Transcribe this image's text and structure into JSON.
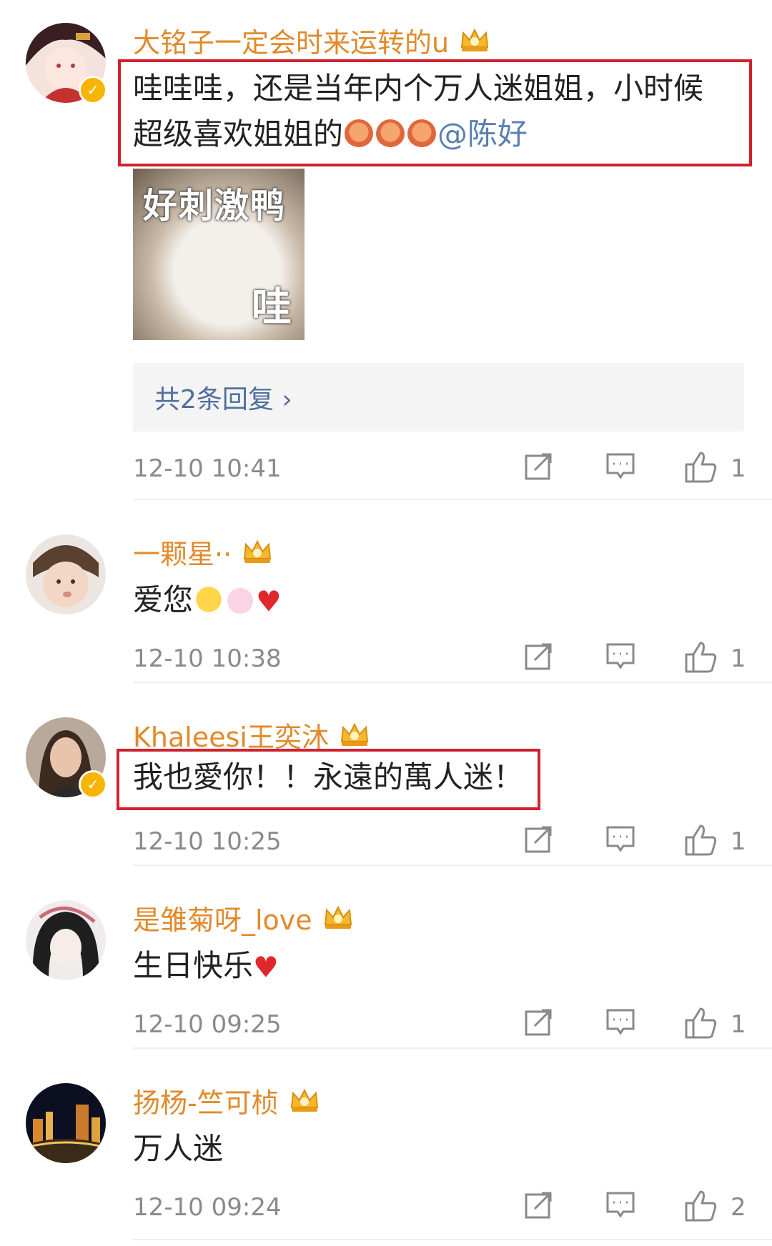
{
  "comments": [
    {
      "username": "大铭子一定会时来运转的u",
      "text_line1": "哇哇哇，还是当年内个万人迷姐姐，小时候",
      "text_line2": "超级喜欢姐姐的",
      "mention": "@陈好",
      "sticker_top": "好刺激鸭",
      "sticker_bottom": "哇",
      "reply_label": "共2条回复 ›",
      "timestamp": "12-10 10:41",
      "likes": "1"
    },
    {
      "username": "一颗星··",
      "text": "爱您",
      "timestamp": "12-10 10:38",
      "likes": "1"
    },
    {
      "username": "Khaleesi王奕沐",
      "text": "我也愛你！！永遠的萬人迷！",
      "timestamp": "12-10 10:25",
      "likes": "1"
    },
    {
      "username": "是雏菊呀_love",
      "text": "生日快乐",
      "timestamp": "12-10 09:25",
      "likes": "1"
    },
    {
      "username": "扬杨-竺可桢",
      "text": "万人迷",
      "timestamp": "12-10 09:24",
      "likes": "2"
    }
  ],
  "icons": {
    "repost": "repost-icon",
    "comment": "comment-icon",
    "like": "thumbs-up-icon",
    "crown": "vip-crown-icon",
    "verified": "verified-badge-icon"
  },
  "colors": {
    "username": "#e08a2b",
    "mention": "#5b7fb3",
    "highlight": "#d1202e",
    "meta": "#8a8a8a"
  }
}
